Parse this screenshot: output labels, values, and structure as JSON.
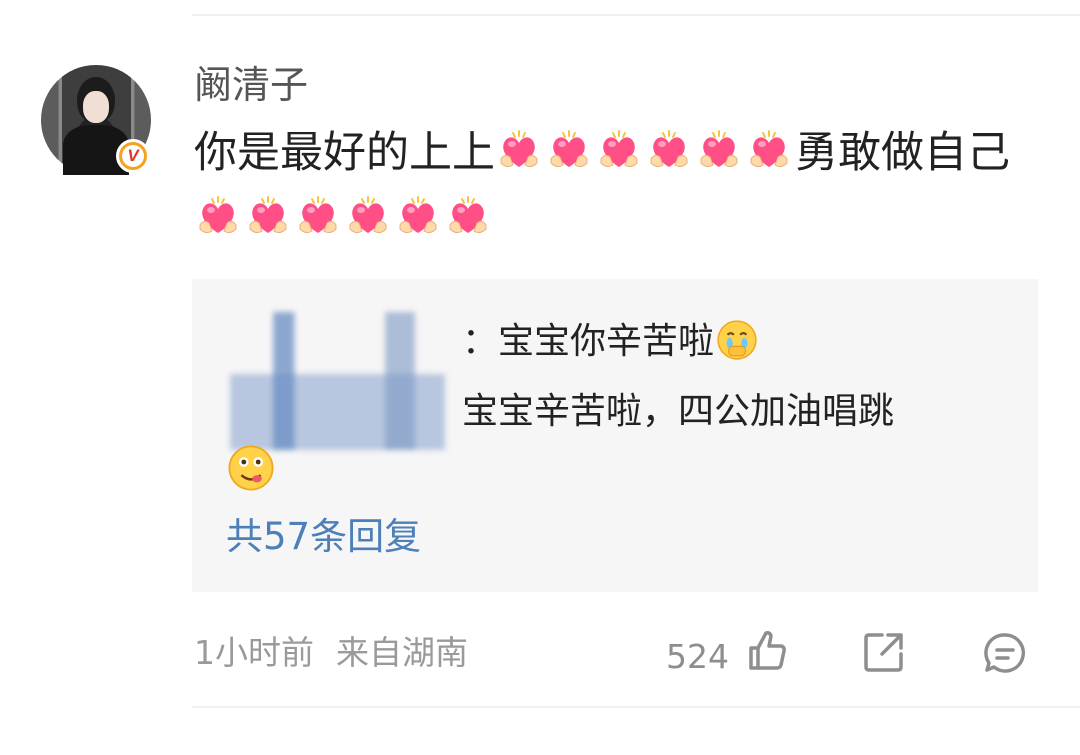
{
  "comment": {
    "username": "阚清子",
    "text_part1": "你是最好的上上",
    "hearts_group1": 6,
    "text_part2": "勇敢做自己",
    "hearts_group2": 6,
    "heart_emoji": "heart-hands-emoji",
    "verified_badge": "V",
    "replies": [
      {
        "text": "：宝宝你辛苦啦",
        "emoji": "crying-face-emoji"
      },
      {
        "text": "宝宝辛苦啦，四公加油唱跳",
        "emoji": "yum-face-emoji"
      }
    ],
    "reply_count_label": "共57条回复",
    "time": "1小时前",
    "location": "来自湖南",
    "like_count": "524"
  },
  "colors": {
    "link_blue": "#4d7fb8",
    "reply_bg": "#f6f6f6",
    "meta_gray": "#9a9a9a",
    "badge_orange": "#f6a21e",
    "heart_pink": "#ff4f86"
  },
  "icons": [
    "thumbs-up-icon",
    "share-icon",
    "comment-bubble-icon"
  ]
}
